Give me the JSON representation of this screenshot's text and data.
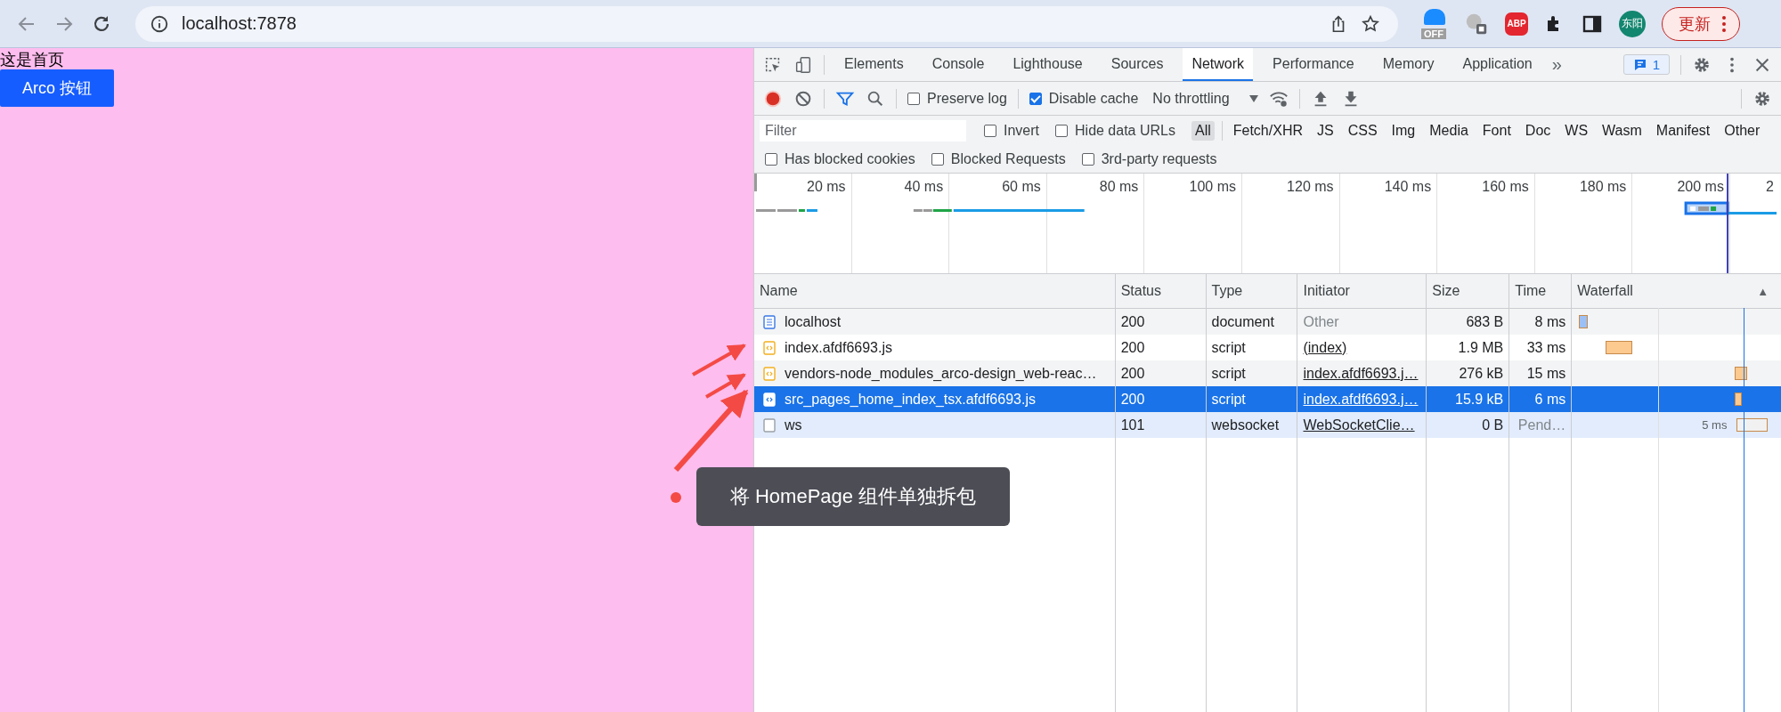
{
  "browser": {
    "address": "localhost:7878",
    "extension_badge": "OFF",
    "adblock_label": "ABP",
    "profile": "东阳",
    "update_button": "更新"
  },
  "page": {
    "heading": "这是首页",
    "button": "Arco 按钮"
  },
  "devtools": {
    "panel_tabs": [
      {
        "label": "Elements",
        "selected": false
      },
      {
        "label": "Console",
        "selected": false
      },
      {
        "label": "Lighthouse",
        "selected": false
      },
      {
        "label": "Sources",
        "selected": false
      },
      {
        "label": "Network",
        "selected": true
      },
      {
        "label": "Performance",
        "selected": false
      },
      {
        "label": "Memory",
        "selected": false
      },
      {
        "label": "Application",
        "selected": false
      }
    ],
    "overflow": "»",
    "issues_count": "1",
    "toolbar": {
      "recording": true,
      "preserve_log": {
        "label": "Preserve log",
        "checked": false
      },
      "disable_cache": {
        "label": "Disable cache",
        "checked": true
      },
      "throttling": "No throttling"
    },
    "filter": {
      "placeholder": "Filter",
      "options": [
        {
          "label": "Invert",
          "checked": false
        },
        {
          "label": "Hide data URLs",
          "checked": false
        }
      ],
      "types": [
        {
          "label": "All",
          "selected": true
        },
        {
          "label": "Fetch/XHR",
          "selected": false
        },
        {
          "label": "JS",
          "selected": false
        },
        {
          "label": "CSS",
          "selected": false
        },
        {
          "label": "Img",
          "selected": false
        },
        {
          "label": "Media",
          "selected": false
        },
        {
          "label": "Font",
          "selected": false
        },
        {
          "label": "Doc",
          "selected": false
        },
        {
          "label": "WS",
          "selected": false
        },
        {
          "label": "Wasm",
          "selected": false
        },
        {
          "label": "Manifest",
          "selected": false
        },
        {
          "label": "Other",
          "selected": false
        }
      ]
    },
    "extra_filters": [
      {
        "label": "Has blocked cookies",
        "checked": false
      },
      {
        "label": "Blocked Requests",
        "checked": false
      },
      {
        "label": "3rd-party requests",
        "checked": false
      }
    ],
    "timeline_ticks": [
      "20 ms",
      "40 ms",
      "60 ms",
      "80 ms",
      "100 ms",
      "120 ms",
      "140 ms",
      "160 ms",
      "180 ms",
      "200 ms",
      "2"
    ],
    "table": {
      "columns": [
        "Name",
        "Status",
        "Type",
        "Initiator",
        "Size",
        "Time",
        "Waterfall"
      ],
      "sort_indicator": "▲",
      "rows": [
        {
          "name": "localhost",
          "kind": "document",
          "status": "200",
          "type": "document",
          "initiator": "Other",
          "initiator_link": false,
          "size": "683 B",
          "time": "8 ms",
          "time_pending": false,
          "selected": false,
          "hovered": false
        },
        {
          "name": "index.afdf6693.js",
          "kind": "script",
          "status": "200",
          "type": "script",
          "initiator": "(index)",
          "initiator_link": true,
          "size": "1.9 MB",
          "time": "33 ms",
          "time_pending": false,
          "selected": false,
          "hovered": false
        },
        {
          "name": "vendors-node_modules_arco-design_web-reac…",
          "kind": "script",
          "status": "200",
          "type": "script",
          "initiator": "index.afdf6693.j…",
          "initiator_link": true,
          "size": "276 kB",
          "time": "15 ms",
          "time_pending": false,
          "selected": false,
          "hovered": false
        },
        {
          "name": "src_pages_home_index_tsx.afdf6693.js",
          "kind": "script",
          "status": "200",
          "type": "script",
          "initiator": "index.afdf6693.j…",
          "initiator_link": true,
          "size": "15.9 kB",
          "time": "6 ms",
          "time_pending": false,
          "selected": true,
          "hovered": false
        },
        {
          "name": "ws",
          "kind": "websocket",
          "status": "101",
          "type": "websocket",
          "initiator": "WebSocketClie…",
          "initiator_link": true,
          "size": "0 B",
          "time": "Pend…",
          "time_pending": true,
          "selected": false,
          "hovered": true,
          "waterfall_label": "5 ms"
        }
      ]
    }
  },
  "annotation": {
    "callout": "将 HomePage 组件单独拆包"
  }
}
